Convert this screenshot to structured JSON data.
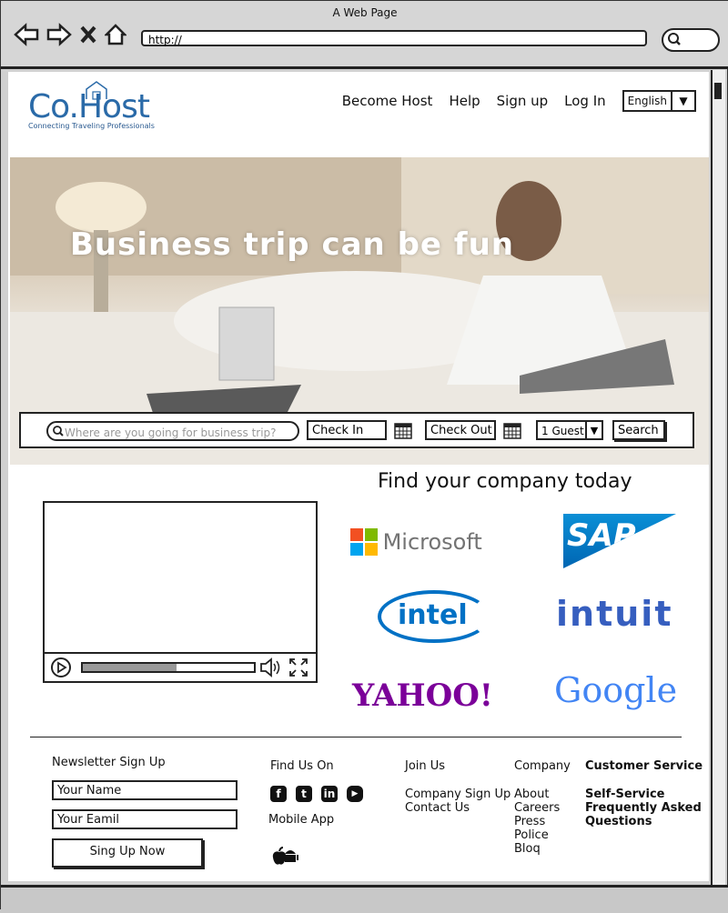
{
  "window": {
    "title": "A Web Page",
    "url": "http://"
  },
  "brand": {
    "name": "Co.Host",
    "tagline": "Connecting Traveling Professionals",
    "color": "#2a6aa8"
  },
  "nav": {
    "become_host": "Become Host",
    "help": "Help",
    "sign_up": "Sign up",
    "log_in": "Log In",
    "language": "English"
  },
  "hero": {
    "headline": "Business trip can be fun",
    "search_placeholder": "Where are you going for business trip?",
    "check_in": "Check In",
    "check_out": "Check Out",
    "guests": "1 Guest",
    "search_button": "Search"
  },
  "companies": {
    "title": "Find your company today",
    "logos": [
      "Microsoft",
      "SAP",
      "intel",
      "intuit",
      "YAHOO!",
      "Google"
    ]
  },
  "footer": {
    "newsletter": {
      "title": "Newsletter Sign Up",
      "name_placeholder": "Your Name",
      "email_placeholder": "Your Eamil",
      "button": "Sing Up Now"
    },
    "find_us": {
      "title": "Find Us On",
      "mobile": "Mobile App"
    },
    "join_us": {
      "title": "Join Us",
      "links": [
        "Company Sign Up",
        "Contact Us"
      ]
    },
    "company": {
      "title": "Company",
      "links": [
        "About",
        "Careers",
        "Press",
        "Police",
        "Bloq"
      ]
    },
    "customer_service": {
      "title": "Customer Service",
      "links": [
        "Self-Service",
        "Frequently Asked Questions"
      ]
    }
  }
}
